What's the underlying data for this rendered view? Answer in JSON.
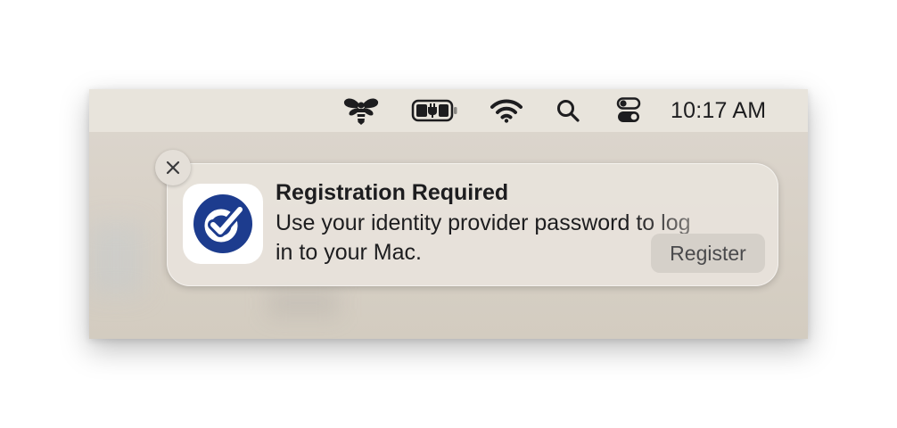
{
  "menubar": {
    "icons": [
      "bee-icon",
      "battery-charging-icon",
      "wifi-icon",
      "search-icon",
      "control-center-icon"
    ],
    "clock": "10:17 AM"
  },
  "notification": {
    "title": "Registration Required",
    "body_line1": "Use your identity provider password to log",
    "body_line2": "in to your Mac.",
    "action_label": "Register",
    "close_glyph": "×",
    "app_icon": "checkmark-badge-icon",
    "app_icon_color": "#1d3c8e"
  }
}
